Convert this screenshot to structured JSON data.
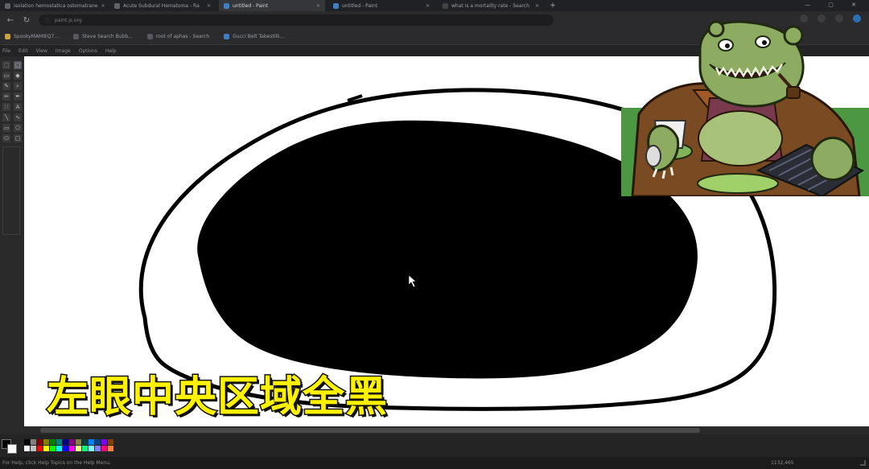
{
  "browser": {
    "tabs": [
      {
        "label": "isolation hemostatica ostomatrane",
        "active": false,
        "favicon": "page-icon"
      },
      {
        "label": "Acute Subdural Hematoma - Ra",
        "active": false,
        "favicon": "page-icon"
      },
      {
        "label": "untitled - Paint",
        "active": true,
        "favicon": "paint-icon"
      },
      {
        "label": "untitled - Paint",
        "active": false,
        "favicon": "paint-icon"
      },
      {
        "label": "what is a mortality rate - Search",
        "active": false,
        "favicon": "search-icon"
      }
    ],
    "new_tab_label": "+",
    "address": "paint.js.org",
    "address_prefix": "ⓘ",
    "bookmarks": [
      {
        "label": "SpookyMAMIEQ7...",
        "favicon": "bookmark-icon"
      },
      {
        "label": "Steve Search Bubb...",
        "favicon": "bookmark-icon"
      },
      {
        "label": "root of aphas - Search",
        "favicon": "bookmark-icon"
      },
      {
        "label": "Gucci Belt Tabestilli...",
        "favicon": "bookmark-icon"
      }
    ]
  },
  "paint": {
    "menu": [
      "File",
      "Edit",
      "View",
      "Image",
      "Options",
      "Help"
    ],
    "tools": [
      {
        "name": "free-select-tool",
        "glyph": "⬚"
      },
      {
        "name": "select-tool",
        "glyph": "□",
        "selected": true
      },
      {
        "name": "eraser-tool",
        "glyph": "▭"
      },
      {
        "name": "fill-tool",
        "glyph": "◆"
      },
      {
        "name": "color-picker-tool",
        "glyph": "✎"
      },
      {
        "name": "magnifier-tool",
        "glyph": "⌕"
      },
      {
        "name": "pencil-tool",
        "glyph": "✏"
      },
      {
        "name": "brush-tool",
        "glyph": "✒"
      },
      {
        "name": "airbrush-tool",
        "glyph": "∷"
      },
      {
        "name": "text-tool",
        "glyph": "A"
      },
      {
        "name": "line-tool",
        "glyph": "╲"
      },
      {
        "name": "curve-tool",
        "glyph": "∿"
      },
      {
        "name": "rectangle-tool",
        "glyph": "▭"
      },
      {
        "name": "polygon-tool",
        "glyph": "⬠"
      },
      {
        "name": "ellipse-tool",
        "glyph": "⬭"
      },
      {
        "name": "rounded-rect-tool",
        "glyph": "▢"
      }
    ],
    "current_colors": {
      "foreground": "#000000",
      "background": "#ffffff"
    },
    "palette": [
      "#000000",
      "#808080",
      "#800000",
      "#808000",
      "#008000",
      "#008080",
      "#000080",
      "#800080",
      "#808040",
      "#004040",
      "#0080ff",
      "#004080",
      "#8000ff",
      "#804000",
      "#ffffff",
      "#c0c0c0",
      "#ff0000",
      "#ffff00",
      "#00ff00",
      "#00ffff",
      "#0000ff",
      "#ff00ff",
      "#ffff80",
      "#00ff80",
      "#80ffff",
      "#8080ff",
      "#ff0080",
      "#ff8040"
    ],
    "status_text": "For Help, click Help Topics on the Help Menu.",
    "coords": "1132,465"
  },
  "caption": "左眼中央区域全黑",
  "colors": {
    "caption_fill": "#fff200",
    "caption_stroke": "#111111",
    "canvas": "#ffffff",
    "ink": "#000000"
  }
}
